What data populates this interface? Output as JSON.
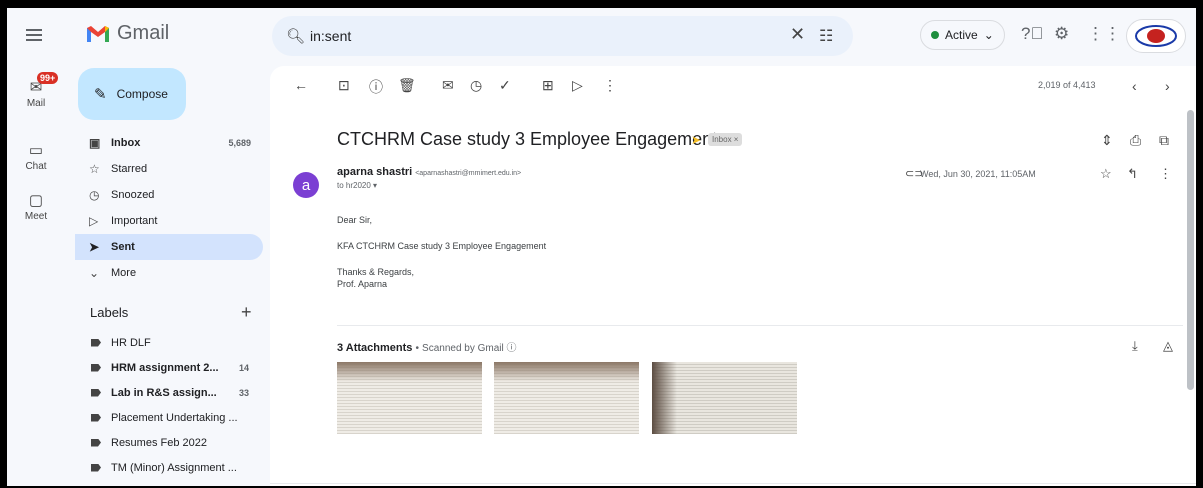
{
  "app": {
    "name": "Gmail",
    "logo_letter": "M"
  },
  "search": {
    "query": "in:sent"
  },
  "status": {
    "label": "Active",
    "caret": "⌄",
    "color": "#1e8e3e"
  },
  "rail": [
    {
      "label": "Mail",
      "badge": "99+"
    },
    {
      "label": "Chat"
    },
    {
      "label": "Meet"
    }
  ],
  "compose": {
    "label": "Compose"
  },
  "nav": [
    {
      "label": "Inbox",
      "count": "5,689"
    },
    {
      "label": "Starred"
    },
    {
      "label": "Snoozed"
    },
    {
      "label": "Important"
    },
    {
      "label": "Sent"
    },
    {
      "label": "More"
    }
  ],
  "labels": {
    "heading": "Labels",
    "items": [
      {
        "label": "HR DLF"
      },
      {
        "label": "HRM assignment 2...",
        "count": "14"
      },
      {
        "label": "Lab in R&S assign...",
        "count": "33"
      },
      {
        "label": "Placement Undertaking ..."
      },
      {
        "label": "Resumes Feb 2022"
      },
      {
        "label": "TM (Minor) Assignment ..."
      }
    ]
  },
  "pager": {
    "text": "2,019 of 4,413"
  },
  "email": {
    "subject": "CTCHRM Case study 3 Employee Engagement",
    "inbox_chip": "Inbox ×",
    "sender_initial": "a",
    "sender_name": "aparna shastri",
    "sender_email": "<aparnashastri@mmimert.edu.in>",
    "to": "to hr2020 ▾",
    "date": "Wed, Jun 30, 2021, 11:05AM",
    "greeting": "Dear Sir,",
    "line1": "KFA CTCHRM Case study 3 Employee Engagement",
    "closing": "Thanks & Regards,",
    "signature": "Prof. Aparna"
  },
  "attachments": {
    "title": "3 Attachments",
    "separator": "•",
    "scanned": "Scanned by Gmail ⓘ"
  }
}
